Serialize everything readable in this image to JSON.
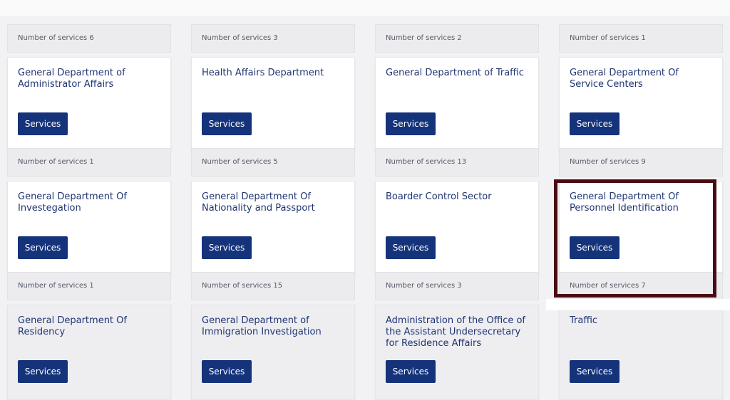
{
  "top_footers": [
    "Number of services 6",
    "Number of services 3",
    "Number of services 2",
    "Number of services 1"
  ],
  "rows": [
    [
      {
        "title": "General Department of Administrator Affairs",
        "button": "Services",
        "footer": "Number of services 1"
      },
      {
        "title": "Health Affairs Department",
        "button": "Services",
        "footer": "Number of services 5"
      },
      {
        "title": "General Department of Traffic",
        "button": "Services",
        "footer": "Number of services 13"
      },
      {
        "title": "General Department Of Service Centers",
        "button": "Services",
        "footer": "Number of services 9"
      }
    ],
    [
      {
        "title": "General Department Of Investegation",
        "button": "Services",
        "footer": "Number of services 1"
      },
      {
        "title": "General Department Of Nationality and Passport",
        "button": "Services",
        "footer": "Number of services 15"
      },
      {
        "title": "Boarder Control Sector",
        "button": "Services",
        "footer": "Number of services 3"
      },
      {
        "title": "General Department Of Personnel Identification",
        "button": "Services",
        "footer": "Number of services 7"
      }
    ],
    [
      {
        "title": "General Department Of Residency",
        "button": "Services"
      },
      {
        "title": "General Department of Immigration Investigation",
        "button": "Services"
      },
      {
        "title": "Administration of the Office of the Assistant Undersecretary for Residence Affairs",
        "button": "Services"
      },
      {
        "title": "Traffic",
        "button": "Services"
      }
    ]
  ],
  "colors": {
    "button_bg": "#14337b",
    "title_text": "#1f3573",
    "highlight_border": "#4a0b12"
  }
}
